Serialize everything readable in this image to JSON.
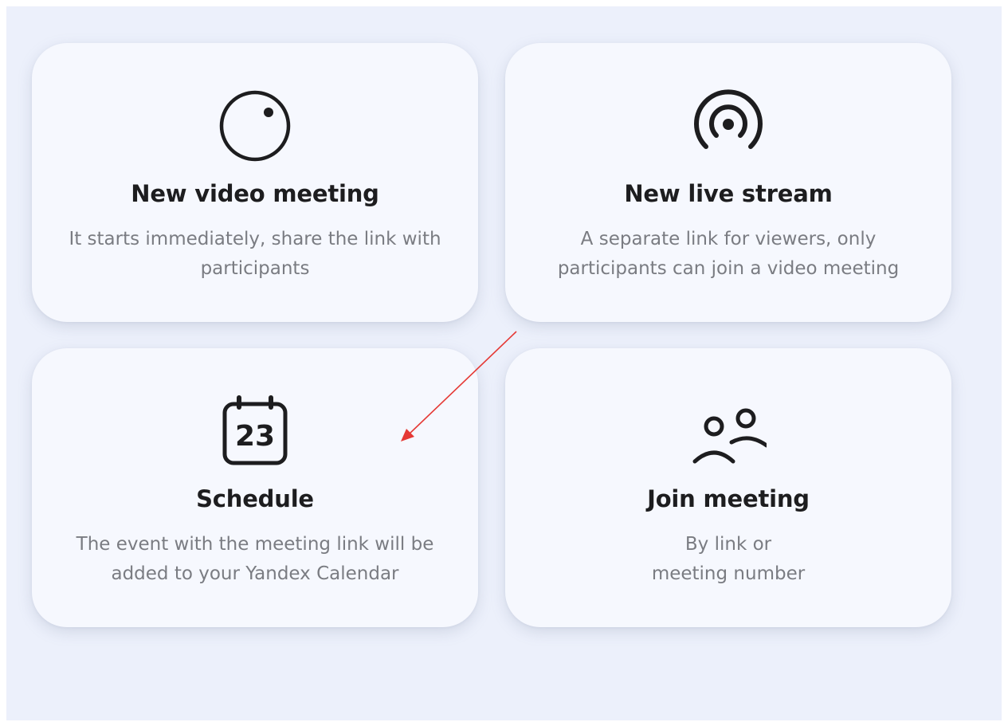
{
  "cards": {
    "video_meeting": {
      "title": "New video meeting",
      "line1": "It starts immediately, share the link with",
      "line2": "participants",
      "icon": "video-camera-icon"
    },
    "live_stream": {
      "title": "New live stream",
      "line1": "A separate link for viewers, only",
      "line2": "participants can join a video meeting",
      "icon": "broadcast-icon"
    },
    "schedule": {
      "title": "Schedule",
      "line1": "The event with the meeting link will be",
      "line2": "added to your Yandex Calendar",
      "icon": "calendar-icon",
      "calendar_day": "23"
    },
    "join_meeting": {
      "title": "Join meeting",
      "line1": "By link or",
      "line2": "meeting number",
      "icon": "people-icon"
    }
  },
  "colors": {
    "page_background": "#ecf0fb",
    "card_background": "#f6f8fe",
    "title_text": "#1d1d1f",
    "description_text": "#7a7c82",
    "annotation_arrow": "#e53935"
  }
}
